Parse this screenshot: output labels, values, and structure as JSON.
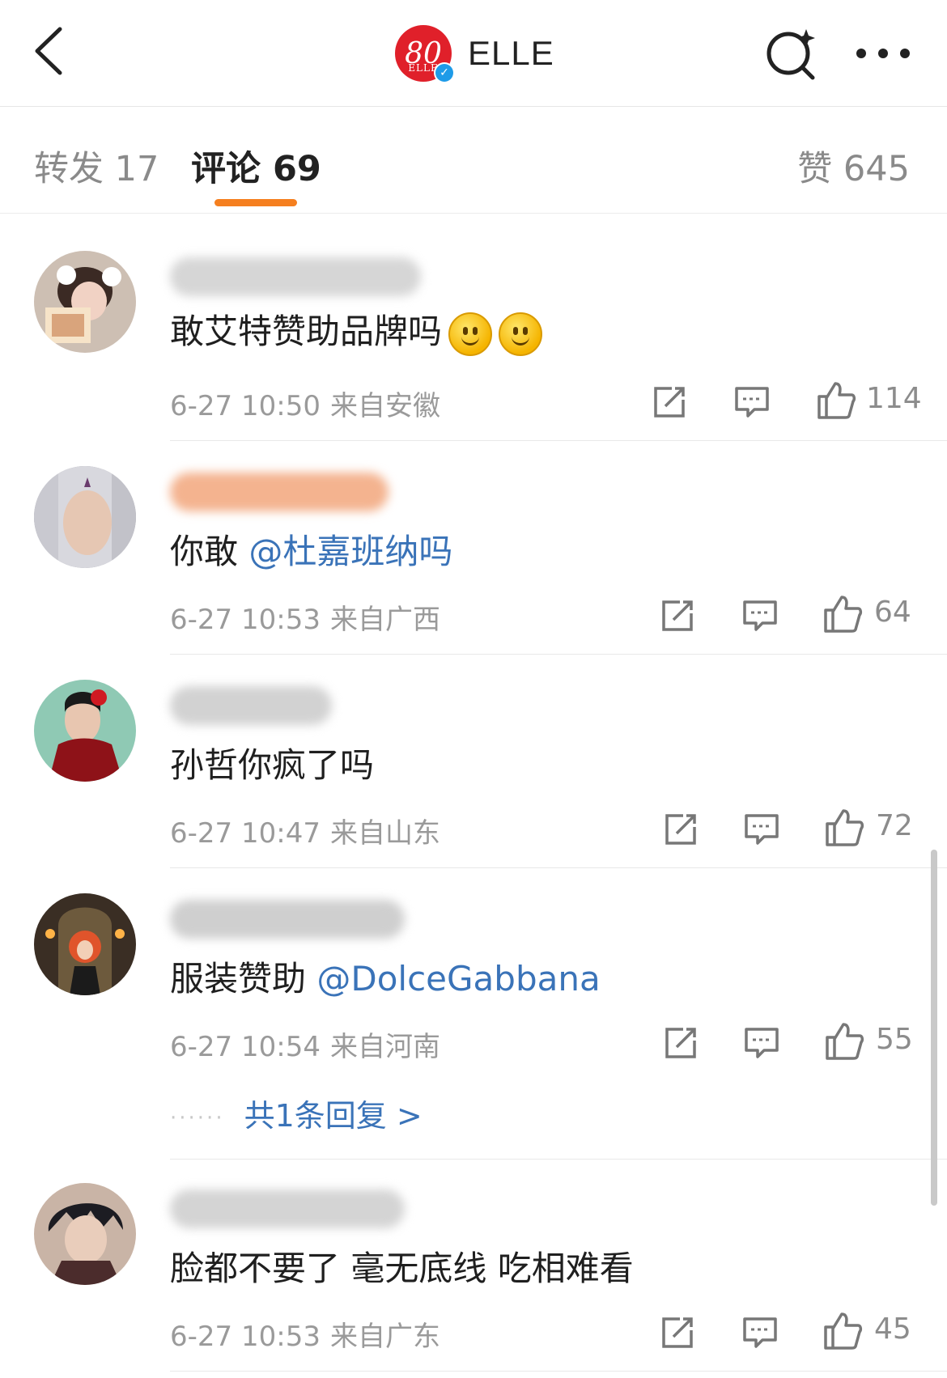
{
  "header": {
    "brand_name": "ELLE",
    "logo_number": "80",
    "logo_text": "ELLE",
    "verified_mark": "✓",
    "back_icon": "chevron-left-icon",
    "search_icon": "sparkle-search-icon",
    "more_icon": "more-dots-icon"
  },
  "tabs": [
    {
      "label": "转发 17",
      "active": false
    },
    {
      "label": "评论 69",
      "active": true
    },
    {
      "label": "赞 645",
      "active": false
    }
  ],
  "accent_color": "#f57f1f",
  "link_color": "#3a73b8",
  "comments": [
    {
      "text": "敢艾特赞助品牌吗",
      "emojis": 2,
      "time": "6-27 10:50",
      "location": "来自安徽",
      "likes": "114"
    },
    {
      "text_prefix": "你敢 ",
      "mention": "@杜嘉班纳吗",
      "time": "6-27 10:53",
      "location": "来自广西",
      "likes": "64"
    },
    {
      "text": "孙哲你疯了吗",
      "time": "6-27 10:47",
      "location": "来自山东",
      "likes": "72"
    },
    {
      "text_prefix": "服装赞助 ",
      "mention": "@DolceGabbana",
      "time": "6-27 10:54",
      "location": "来自河南",
      "likes": "55",
      "reply_dots": "······",
      "reply_link": "共1条回复 >"
    },
    {
      "text": "脸都不要了 毫无底线 吃相难看",
      "time": "6-27 10:53",
      "location": "来自广东",
      "likes": "45"
    }
  ]
}
